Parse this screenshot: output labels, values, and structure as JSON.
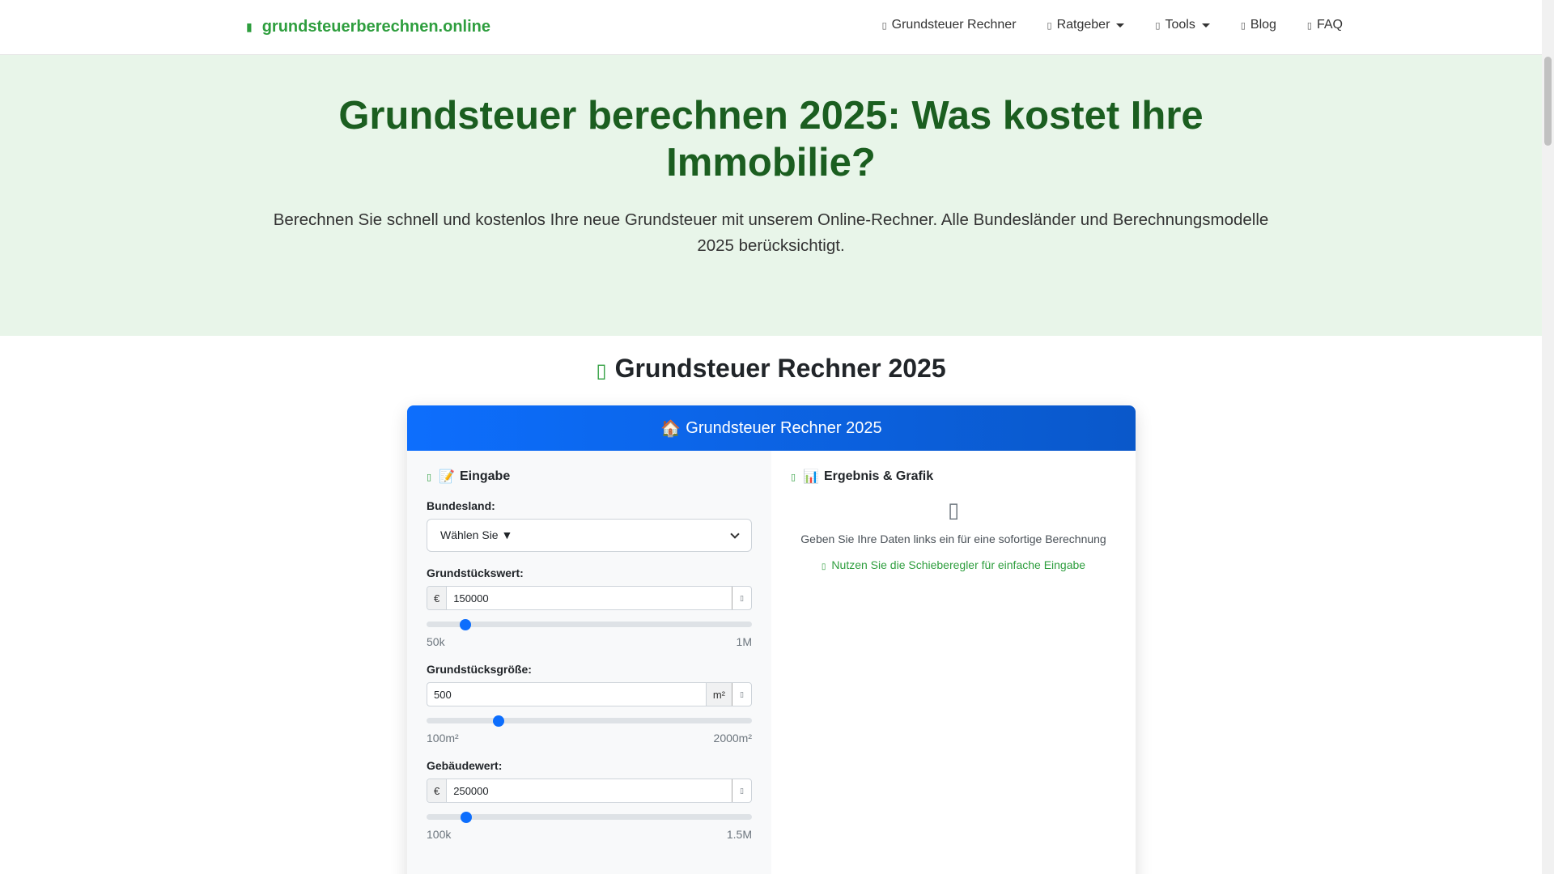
{
  "nav": {
    "brand": "grundsteuerberechnen.online",
    "brand_icon": "calculator-icon",
    "items": [
      {
        "label": "Grundsteuer Rechner",
        "icon": "calculator-icon"
      },
      {
        "label": "Ratgeber",
        "icon": "book-icon",
        "dropdown": true
      },
      {
        "label": "Tools",
        "icon": "tools-icon",
        "dropdown": true
      },
      {
        "label": "Blog",
        "icon": "blog-icon"
      },
      {
        "label": "FAQ",
        "icon": "question-icon"
      }
    ]
  },
  "hero": {
    "title": "Grundsteuer berechnen 2025: Was kostet Ihre Immobilie?",
    "subtitle": "Berechnen Sie schnell und kostenlos Ihre neue Grundsteuer mit unserem Online-Rechner. Alle Bundesländer und Berechnungsmodelle 2025 berücksichtigt."
  },
  "section": {
    "title": "Grundsteuer Rechner 2025"
  },
  "card": {
    "header_emoji": "🏠",
    "header": "Grundsteuer Rechner 2025",
    "left": {
      "emoji": "📝",
      "title": "Eingabe",
      "state": {
        "label": "Bundesland:",
        "selected": "Wählen Sie ▼"
      },
      "fields": [
        {
          "label": "Grundstückswert:",
          "prefix": "€",
          "value": "150000",
          "min_label": "50k",
          "max_label": "1M",
          "slider": 150000,
          "slider_min": 50000,
          "slider_max": 1000000
        },
        {
          "label": "Grundstücksgröße:",
          "suffix": "m²",
          "value": "500",
          "min_label": "100m²",
          "max_label": "2000m²",
          "slider": 500,
          "slider_min": 100,
          "slider_max": 2000
        },
        {
          "label": "Gebäudewert:",
          "prefix": "€",
          "value": "250000",
          "min_label": "100k",
          "max_label": "1.5M",
          "slider": 250000,
          "slider_min": 100000,
          "slider_max": 1500000
        }
      ]
    },
    "right": {
      "emoji": "📊",
      "title": "Ergebnis & Grafik",
      "message": "Geben Sie Ihre Daten links ein für eine sofortige Berechnung",
      "tip": "Nutzen Sie die Schieberegler für einfache Eingabe"
    }
  },
  "colors": {
    "primary": "#0d6efd",
    "brand_green": "#2e9e3e",
    "hero_bg": "#e8f5e9",
    "hero_title": "#1b5e20"
  }
}
